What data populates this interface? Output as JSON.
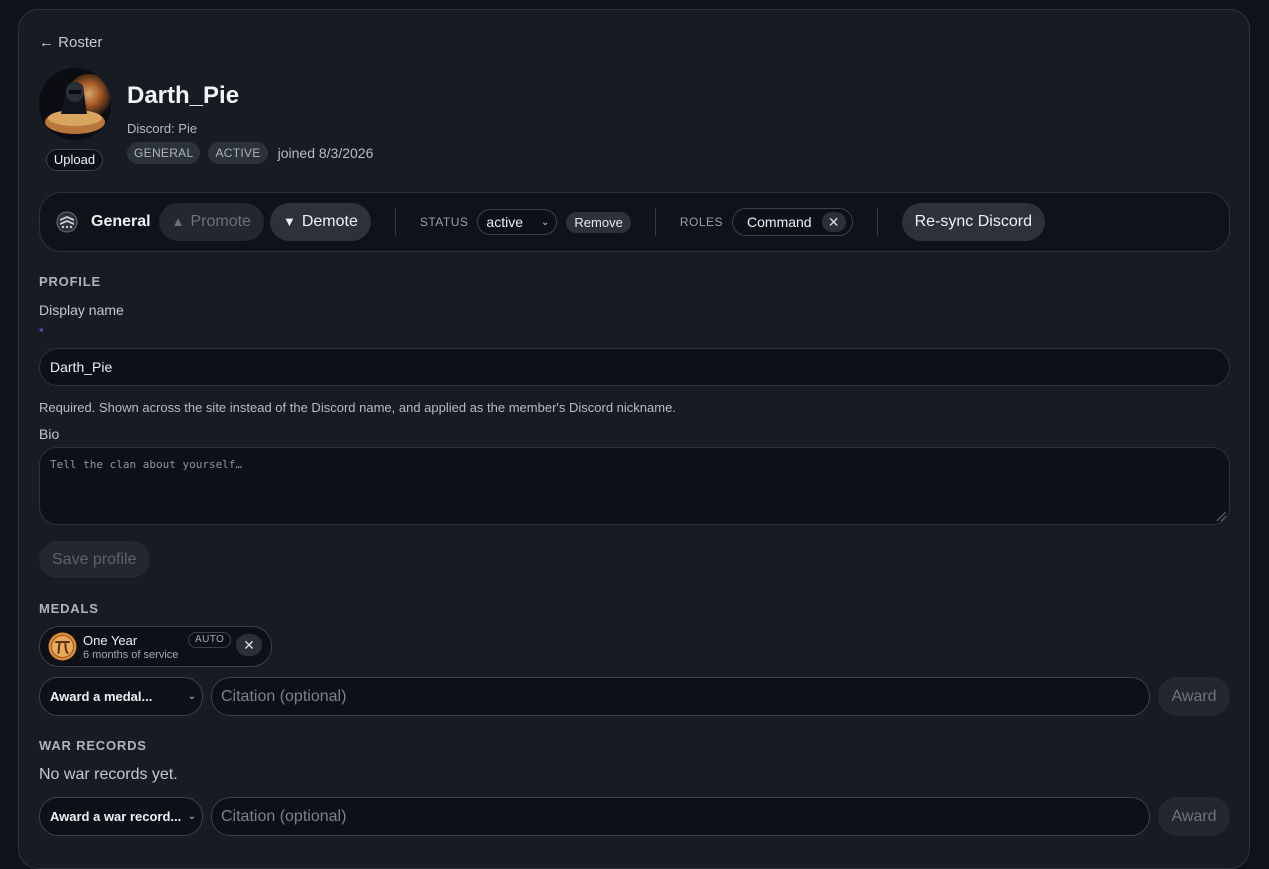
{
  "nav": {
    "back_label": "← Roster"
  },
  "member": {
    "name": "Darth_Pie",
    "discord": "Discord: Pie",
    "rank_chip": "GENERAL",
    "status_chip": "ACTIVE",
    "joined": "joined 8/3/2026",
    "upload_label": "Upload"
  },
  "toolbar": {
    "rank_name": "General",
    "promote_label": "Promote",
    "demote_label": "Demote",
    "status_label": "STATUS",
    "status_value": "active",
    "remove_label": "Remove",
    "roles_label": "ROLES",
    "role_tag": "Command",
    "resync_label": "Re-sync Discord"
  },
  "profile": {
    "section_title": "PROFILE",
    "display_name_label": "Display name",
    "required_mark": "*",
    "display_name_value": "Darth_Pie",
    "hint": "Required. Shown across the site instead of the Discord name, and applied as the member's Discord nickname.",
    "bio_label": "Bio",
    "bio_placeholder": "Tell the clan about yourself…",
    "save_label": "Save profile"
  },
  "medals": {
    "section_title": "MEDALS",
    "items": [
      {
        "name": "One Year",
        "subtitle": "6 months of service",
        "badge": "AUTO"
      }
    ],
    "select_label": "Award a medal...",
    "citation_placeholder": "Citation (optional)",
    "award_label": "Award"
  },
  "war_records": {
    "section_title": "WAR RECORDS",
    "empty_text": "No war records yet.",
    "select_label": "Award a war record...",
    "citation_placeholder": "Citation (optional)",
    "award_label": "Award"
  },
  "colors": {
    "background": "#0f1218",
    "card": "#171b22",
    "accent_required": "#7a5cff",
    "medal_gold": "#d98b3a"
  }
}
